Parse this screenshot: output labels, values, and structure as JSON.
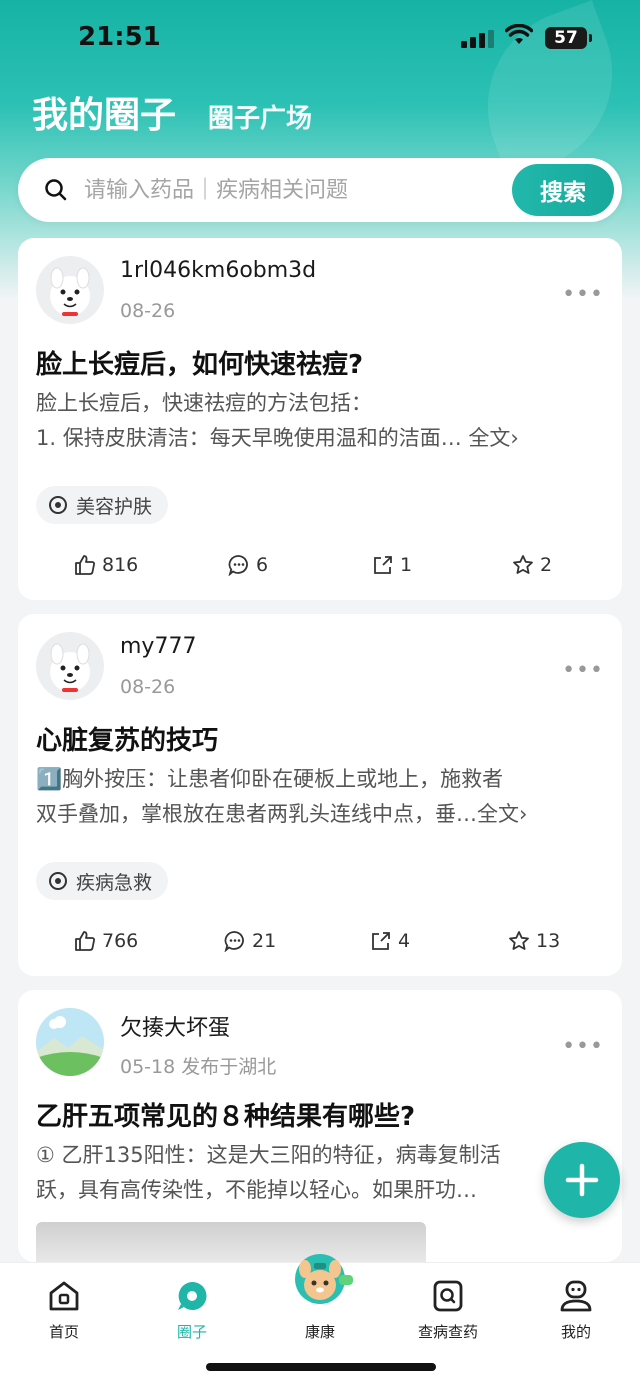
{
  "status_bar": {
    "time": "21:51",
    "battery": "57"
  },
  "top_tabs": {
    "active": "我的圈子",
    "other": "圈子广场"
  },
  "search": {
    "placeholder": "请输入药品｜疾病相关问题",
    "button": "搜索"
  },
  "posts": [
    {
      "username": "1rl046km6obm3d",
      "date": "08-26",
      "title": "脸上长痘后，如何快速祛痘?",
      "excerpt_line1": "脸上长痘后，快速祛痘的方法包括：",
      "excerpt_line2": "1.   保持皮肤清洁：每天早晚使用温和的洁面…",
      "read_more": "全文›",
      "tag": "美容护肤",
      "likes": "816",
      "comments": "6",
      "shares": "1",
      "favorites": "2"
    },
    {
      "username": "my777",
      "date": "08-26",
      "title": "心脏复苏的技巧",
      "excerpt_line1": "1️⃣胸外按压：让患者仰卧在硬板上或地上，施救者",
      "excerpt_line2": "双手叠加，掌根放在患者两乳头连线中点，垂…",
      "read_more": "全文›",
      "tag": "疾病急救",
      "likes": "766",
      "comments": "21",
      "shares": "4",
      "favorites": "13"
    },
    {
      "username": "欠揍大坏蛋",
      "date": "05-18 发布于湖北",
      "title": "乙肝五项常见的８种结果有哪些?",
      "excerpt_line1": "① 乙肝135阳性：这是大三阳的特征，病毒复制活",
      "excerpt_line2": "跃，具有高传染性，不能掉以轻心。如果肝功…"
    }
  ],
  "bottom_nav": [
    {
      "label": "首页",
      "icon": "home-icon"
    },
    {
      "label": "圈子",
      "icon": "circle-icon",
      "active": true
    },
    {
      "label": "康康",
      "icon": "mascot-icon"
    },
    {
      "label": "查病查药",
      "icon": "search-doc-icon"
    },
    {
      "label": "我的",
      "icon": "profile-icon"
    }
  ],
  "colors": {
    "accent": "#1fb5a8"
  }
}
